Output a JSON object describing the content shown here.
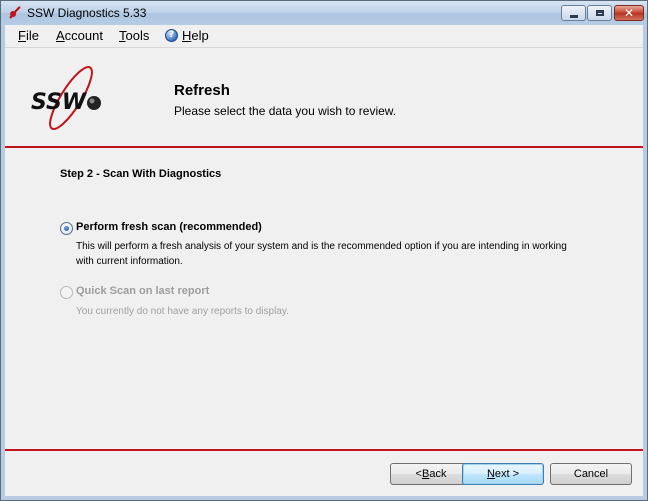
{
  "window": {
    "title": "SSW Diagnostics 5.33"
  },
  "menu": {
    "items": [
      {
        "label": "File",
        "accel": "F",
        "rest": "ile"
      },
      {
        "label": "Account",
        "accel": "A",
        "rest": "ccount"
      },
      {
        "label": "Tools",
        "accel": "T",
        "rest": "ools"
      },
      {
        "label": "Help",
        "accel": "H",
        "rest": "elp"
      }
    ]
  },
  "header": {
    "title": "Refresh",
    "subtitle": "Please select the data you wish to review.",
    "logo_text": "SSW"
  },
  "step": {
    "title": "Step 2 - Scan With Diagnostics"
  },
  "options": [
    {
      "label": "Perform fresh scan (recommended)",
      "description": "This will perform a fresh analysis of your system and is the recommended option if you are intending in working with current information.",
      "checked": true,
      "enabled": true
    },
    {
      "label": "Quick Scan on last report",
      "description": "You currently do not have any reports to display.",
      "checked": false,
      "enabled": false
    }
  ],
  "buttons": {
    "back": {
      "before": "< ",
      "accel": "B",
      "rest": "ack"
    },
    "next": {
      "accel": "N",
      "rest": "ext >"
    },
    "cancel": {
      "label": "Cancel"
    }
  },
  "colors": {
    "accent_red": "#c0141b",
    "disabled_text": "#9d9d9d"
  },
  "icons": {
    "app": "ssw-app-icon",
    "help": "help-icon",
    "logo": "ssw-logo"
  }
}
